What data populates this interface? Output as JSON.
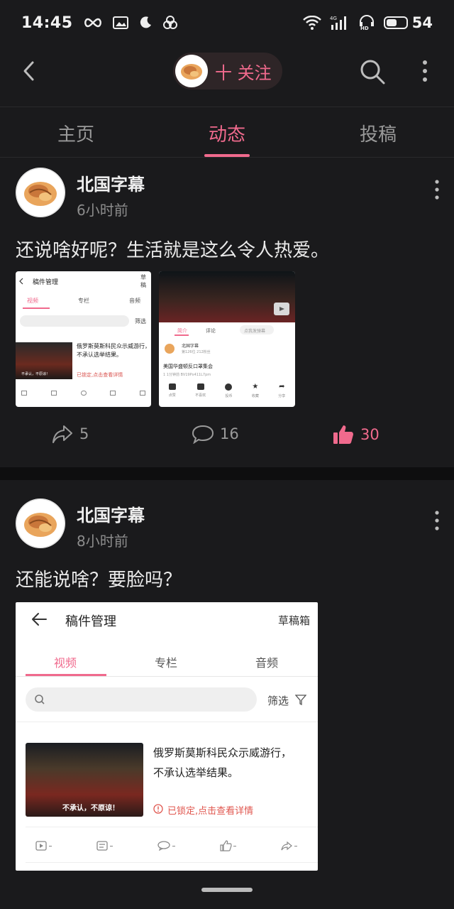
{
  "status": {
    "time": "14:45",
    "battery": "54",
    "battery_level": 0.54
  },
  "header": {
    "follow_label": "十 关注"
  },
  "tabs": [
    {
      "label": "主页"
    },
    {
      "label": "动态"
    },
    {
      "label": "投稿"
    }
  ],
  "active_tab": 1,
  "posts": [
    {
      "author": "北国字幕",
      "time": "6小时前",
      "text": "还说啥好呢？生活就是这么令人热爱。",
      "shares": "5",
      "comments": "16",
      "likes": "30",
      "img1": {
        "title": "稿件管理",
        "drafts": "草稿",
        "tabs": [
          "视频",
          "专栏",
          "音频"
        ],
        "filter": "筛选",
        "video_title": "俄罗斯莫斯科民众示威游行，不承认选举结果。",
        "locked": "已锁定,点击查看详情",
        "caption": "不承认，不原谅！"
      },
      "img2": {
        "tab_intro": "简介",
        "tab_comments": "评论",
        "comment_placeholder": "点我发弹幕",
        "uploader": "北国字幕",
        "uploader_meta": "第126位  212粉丝",
        "video_title": "美国华盛顿反口罩集会",
        "video_meta": "1  1分钟前  BV19Px411L7pm",
        "buttons": [
          "点赞",
          "不喜欢",
          "投币",
          "收藏",
          "分享"
        ]
      }
    },
    {
      "author": "北国字幕",
      "time": "8小时前",
      "text": "还能说啥？要脸吗？",
      "img": {
        "title": "稿件管理",
        "drafts": "草稿箱",
        "tabs": [
          "视频",
          "专栏",
          "音频"
        ],
        "filter": "筛选",
        "video_title_1": "俄罗斯莫斯科民众示威游行，",
        "video_title_2": "不承认选举结果。",
        "locked": "已锁定,点击查看详情",
        "caption": "不承认，不原谅！"
      }
    }
  ]
}
